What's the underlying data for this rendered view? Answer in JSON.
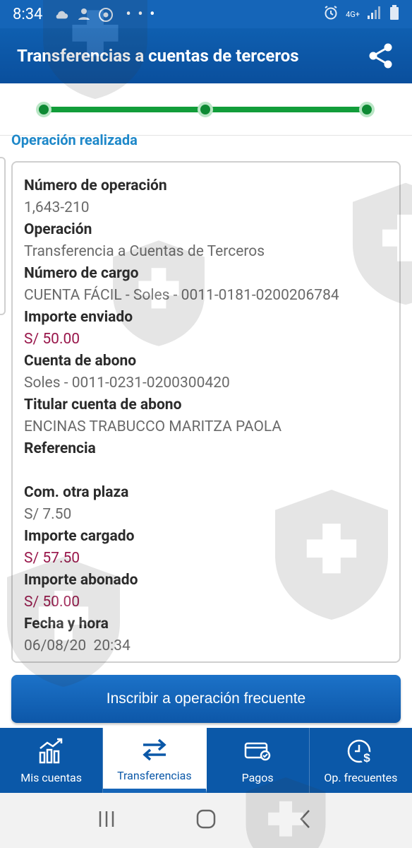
{
  "status_bar": {
    "time": "8:34",
    "icons": [
      "cloud-icon",
      "app-icon",
      "chrome-icon",
      "more-icon",
      "alarm-icon",
      "lte-icon",
      "signal-icon",
      "battery-icon"
    ],
    "dots": "• • •",
    "network": "4G+"
  },
  "app_bar": {
    "title": "Transferencias a cuentas de terceros",
    "share_icon": "share-icon"
  },
  "stepper": {
    "steps": 3,
    "completed": 3,
    "color": "#129d3a"
  },
  "section_title": "Operación realizada",
  "details": [
    {
      "label": "Número de operación",
      "value": "1,643-210"
    },
    {
      "label": "Operación",
      "value": "Transferencia a Cuentas de Terceros"
    },
    {
      "label": "Número de cargo",
      "value": "CUENTA FÁCIL - Soles - 0011-0181-0200206784"
    },
    {
      "label": "Importe enviado",
      "value": "S/ 50.00"
    },
    {
      "label": "Cuenta de abono",
      "value": "Soles - 0011-0231-0200300420"
    },
    {
      "label": "Titular cuenta de abono",
      "value": "ENCINAS TRABUCCO MARITZA PAOLA"
    },
    {
      "label": "Referencia",
      "value": ""
    },
    {
      "label": "Com. otra plaza",
      "value": "S/ 7.50"
    },
    {
      "label": "Importe cargado",
      "value": "S/ 57.50"
    },
    {
      "label": "Importe abonado",
      "value": "S/ 50.00"
    },
    {
      "label": "Fecha y hora",
      "value": "06/08/20  20:34"
    }
  ],
  "colors": {
    "primary": "#0b58a8",
    "money": "#98164a",
    "section": "#1e88c9"
  },
  "primary_button": "Inscribir a operación frecuente",
  "bottom_nav": [
    {
      "label": "Mis cuentas",
      "icon": "chart-icon"
    },
    {
      "label": "Transferencias",
      "icon": "transfer-arrows-icon"
    },
    {
      "label": "Pagos",
      "icon": "card-check-icon"
    },
    {
      "label": "Op. frecuentes",
      "icon": "clock-dollar-icon"
    }
  ],
  "system_nav": [
    "recent-apps-icon",
    "home-icon",
    "back-icon"
  ]
}
